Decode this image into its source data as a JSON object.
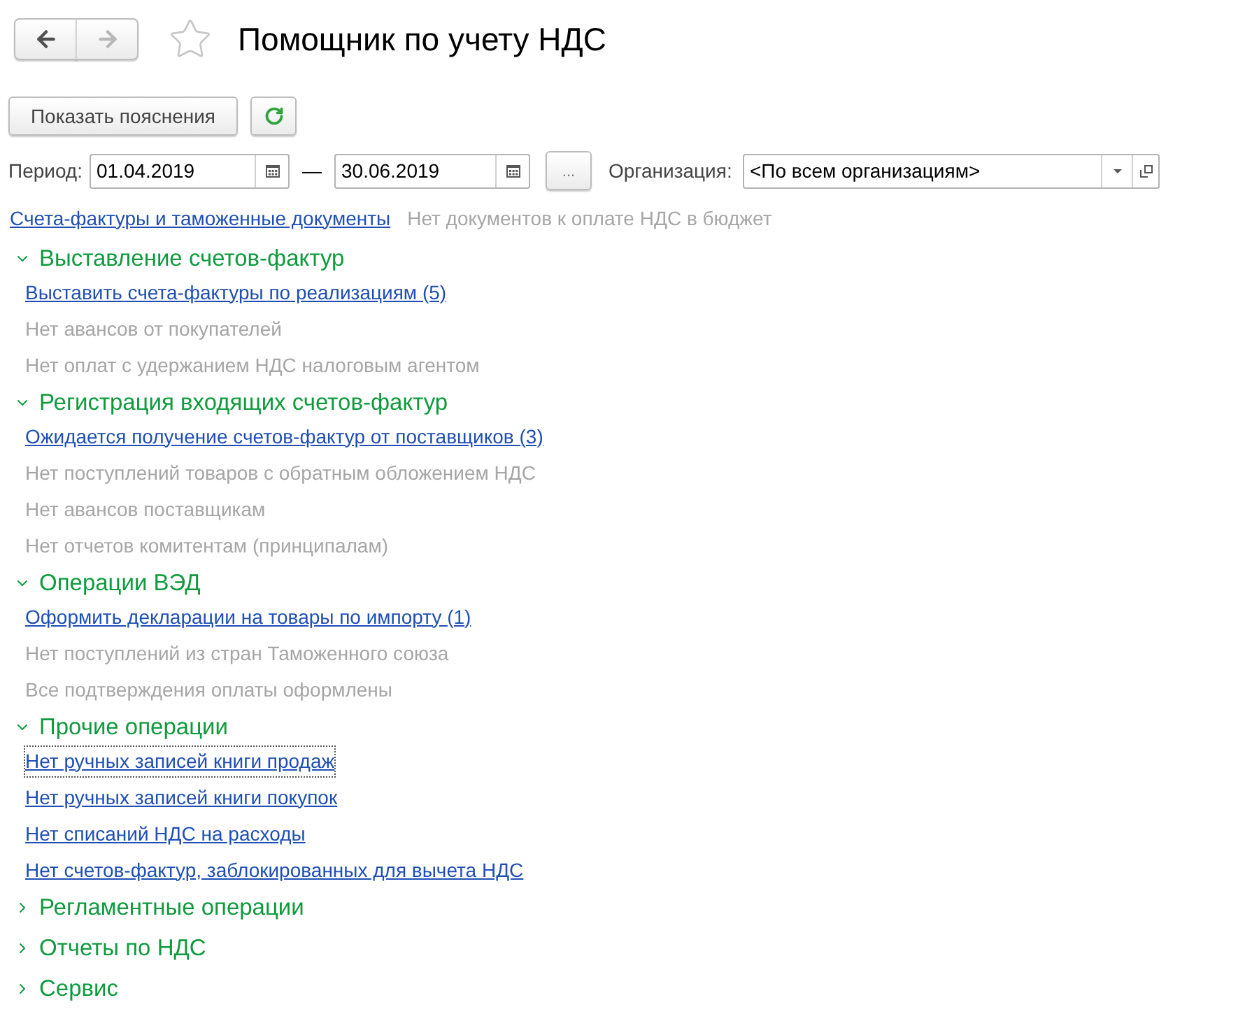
{
  "window": {
    "title": "Помощник по учету НДС",
    "starred": false
  },
  "navigation": [
    {
      "kind": "back",
      "disabled": false
    },
    {
      "kind": "forward",
      "disabled": true
    }
  ],
  "toolbar": [
    {
      "kind": "text",
      "label": "Показать пояснения"
    },
    {
      "kind": "refresh"
    }
  ],
  "filters": {
    "period_label": "Период:",
    "date_from": "01.04.2019",
    "dash": "—",
    "date_to": "30.06.2019",
    "period_button": "...",
    "organization_label": "Организация:",
    "organization": "<По всем организациям>"
  },
  "summary": [
    {
      "kind": "link",
      "text": "Счета-фактуры и таможенные документы"
    },
    {
      "kind": "note",
      "text": "Нет документов к оплате НДС в бюджет"
    }
  ],
  "sections": [
    {
      "title": "Выставление счетов-фактур",
      "expanded": true,
      "items": [
        {
          "kind": "link",
          "text": "Выставить счета-фактуры по реализациям (5)",
          "focused": false
        },
        {
          "kind": "note",
          "text": "Нет авансов от покупателей",
          "focused": false
        },
        {
          "kind": "note",
          "text": "Нет оплат с удержанием НДС налоговым агентом",
          "focused": false
        }
      ]
    },
    {
      "title": "Регистрация входящих счетов-фактур",
      "expanded": true,
      "items": [
        {
          "kind": "link",
          "text": "Ожидается получение счетов-фактур от поставщиков (3)",
          "focused": false
        },
        {
          "kind": "note",
          "text": "Нет поступлений товаров с обратным обложением НДС",
          "focused": false
        },
        {
          "kind": "note",
          "text": "Нет авансов поставщикам",
          "focused": false
        },
        {
          "kind": "note",
          "text": "Нет отчетов комитентам (принципалам)",
          "focused": false
        }
      ]
    },
    {
      "title": "Операции ВЭД",
      "expanded": true,
      "items": [
        {
          "kind": "link",
          "text": "Оформить декларации на товары по импорту (1)",
          "focused": false
        },
        {
          "kind": "note",
          "text": "Нет поступлений из стран Таможенного союза",
          "focused": false
        },
        {
          "kind": "note",
          "text": "Все подтверждения оплаты оформлены",
          "focused": false
        }
      ]
    },
    {
      "title": "Прочие операции",
      "expanded": true,
      "items": [
        {
          "kind": "link",
          "text": "Нет ручных записей книги продаж",
          "focused": true
        },
        {
          "kind": "link",
          "text": "Нет ручных записей книги покупок",
          "focused": false
        },
        {
          "kind": "link",
          "text": "Нет списаний НДС на расходы",
          "focused": false
        },
        {
          "kind": "link",
          "text": "Нет счетов-фактур, заблокированных для вычета НДС",
          "focused": false
        }
      ]
    },
    {
      "title": "Регламентные операции",
      "expanded": false
    },
    {
      "title": "Отчеты по НДС",
      "expanded": false
    },
    {
      "title": "Сервис",
      "expanded": false
    }
  ]
}
